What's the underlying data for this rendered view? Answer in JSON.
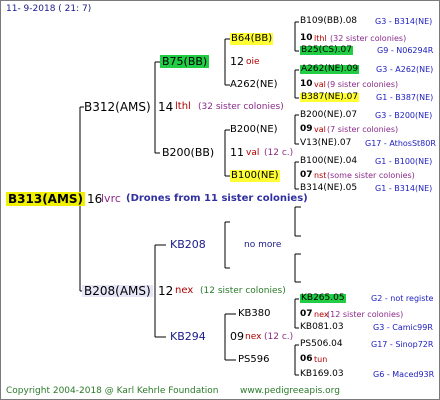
{
  "header": {
    "date": "11-  9-2018 ( 21:  7)"
  },
  "root": {
    "label": "B313(AMS)",
    "gen": "16",
    "mark": "lvrc",
    "note": "(Drones from 11 sister colonies)"
  },
  "gen1": [
    {
      "label": "B312(AMS)",
      "gen": "14",
      "mark": "lthl",
      "note": "(32 sister colonies)"
    },
    {
      "label": "B208(AMS)",
      "gen": "12",
      "mark": "nex",
      "note": "(12 sister colonies)"
    }
  ],
  "gen2": [
    {
      "label": "B75(BB)",
      "gen": "12",
      "mark": "oie"
    },
    {
      "label": "B200(BB)",
      "gen": "11",
      "mark": "val",
      "note": "(12 c.)"
    },
    {
      "label": "KB208",
      "no_more": "no more"
    },
    {
      "label": "KB294",
      "gen": "09",
      "mark": "nex",
      "note": "(12 c.)"
    }
  ],
  "gen3": [
    {
      "label": "B64(BB)",
      "gen": "10",
      "mark": "lthl",
      "note": "(32 sister colonies)"
    },
    {
      "label": "A262(NE)",
      "gen": "10",
      "mark": "val",
      "note": "(9 sister colonies)"
    },
    {
      "label": "B200(NE)",
      "gen": "09",
      "mark": "val",
      "note": "(7 sister colonies)"
    },
    {
      "label": "B100(NE)",
      "gen": "07",
      "mark": "nst",
      "note": "(some sister colonies)"
    },
    {
      "label": "KB380",
      "gen": "07",
      "mark": "nex",
      "note": "(12 sister colonies)"
    },
    {
      "label": "PS596",
      "gen": "06",
      "mark": "tun"
    }
  ],
  "gen4": [
    {
      "label": "B109(BB).08",
      "code": "G3 - B314(NE)"
    },
    {
      "label": "B25(CS).07",
      "code": "G9 - N06294R"
    },
    {
      "label": "A262(NE).09",
      "code": "G3 - A262(NE)"
    },
    {
      "label": "B387(NE).07",
      "code": "G1 - B387(NE)"
    },
    {
      "label": "B200(NE).07",
      "code": "G3 - B200(NE)"
    },
    {
      "label": "V13(NE).07",
      "code": "G17 - AthosSt80R"
    },
    {
      "label": "B100(NE).04",
      "code": "G1 - B100(NE)"
    },
    {
      "label": "B314(NE).05",
      "code": "G1 - B314(NE)"
    },
    {
      "label": "KB265.05",
      "code": "G2 - not registe"
    },
    {
      "label": "KB081.03",
      "code": "G3 - Camic99R"
    },
    {
      "label": "PS506.04",
      "code": "G17 - Sinop72R"
    },
    {
      "label": "KB169.03",
      "code": "G6 - Maced93R"
    }
  ],
  "footer": {
    "copyright": "Copyright 2004-2018 @ Karl Kehrle Foundation",
    "url": "www.pedigreeapis.org"
  },
  "colors": {
    "gold": "#f0f000",
    "green": "#22cc44",
    "lavender": "#e6e6f8",
    "line": "#000000"
  }
}
